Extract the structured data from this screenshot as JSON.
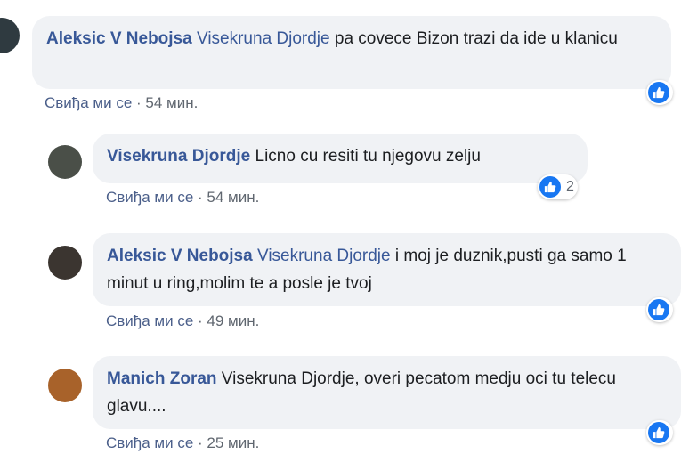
{
  "comments": [
    {
      "author": "Aleksic V Nebojsa",
      "mention": "Visekruna Djordje",
      "text": " pa covece Bizon trazi da ide u klanicu",
      "like_label": "Свиђа ми се",
      "separator": " · ",
      "time": "54 мин.",
      "reactions": "",
      "avatar_color": "#2f3a40"
    },
    {
      "author": "Visekruna Djordje",
      "mention": "",
      "text": " Licno cu resiti tu njegovu zelju",
      "like_label": "Свиђа ми се",
      "separator": " · ",
      "time": "54 мин.",
      "reactions": "2",
      "avatar_color": "#4a4f48"
    },
    {
      "author": "Aleksic V Nebojsa",
      "mention": "Visekruna Djordje",
      "text": " i moj je duznik,pusti ga samo 1 minut u ring,molim te a posle je tvoj",
      "like_label": "Свиђа ми се",
      "separator": " · ",
      "time": "49 мин.",
      "reactions": "",
      "avatar_color": "#3b3530"
    },
    {
      "author": "Manich Zoran",
      "mention": "",
      "text": " Visekruna Djordje, overi pecatom medju oci tu telecu glavu....",
      "like_label": "Свиђа ми се",
      "separator": " · ",
      "time": "25 мин.",
      "reactions": "",
      "avatar_color": "#a8622a"
    }
  ],
  "colors": {
    "link": "#385898",
    "bubble": "#f0f2f5",
    "like_blue": "#1877f2",
    "meta": "#606770"
  }
}
